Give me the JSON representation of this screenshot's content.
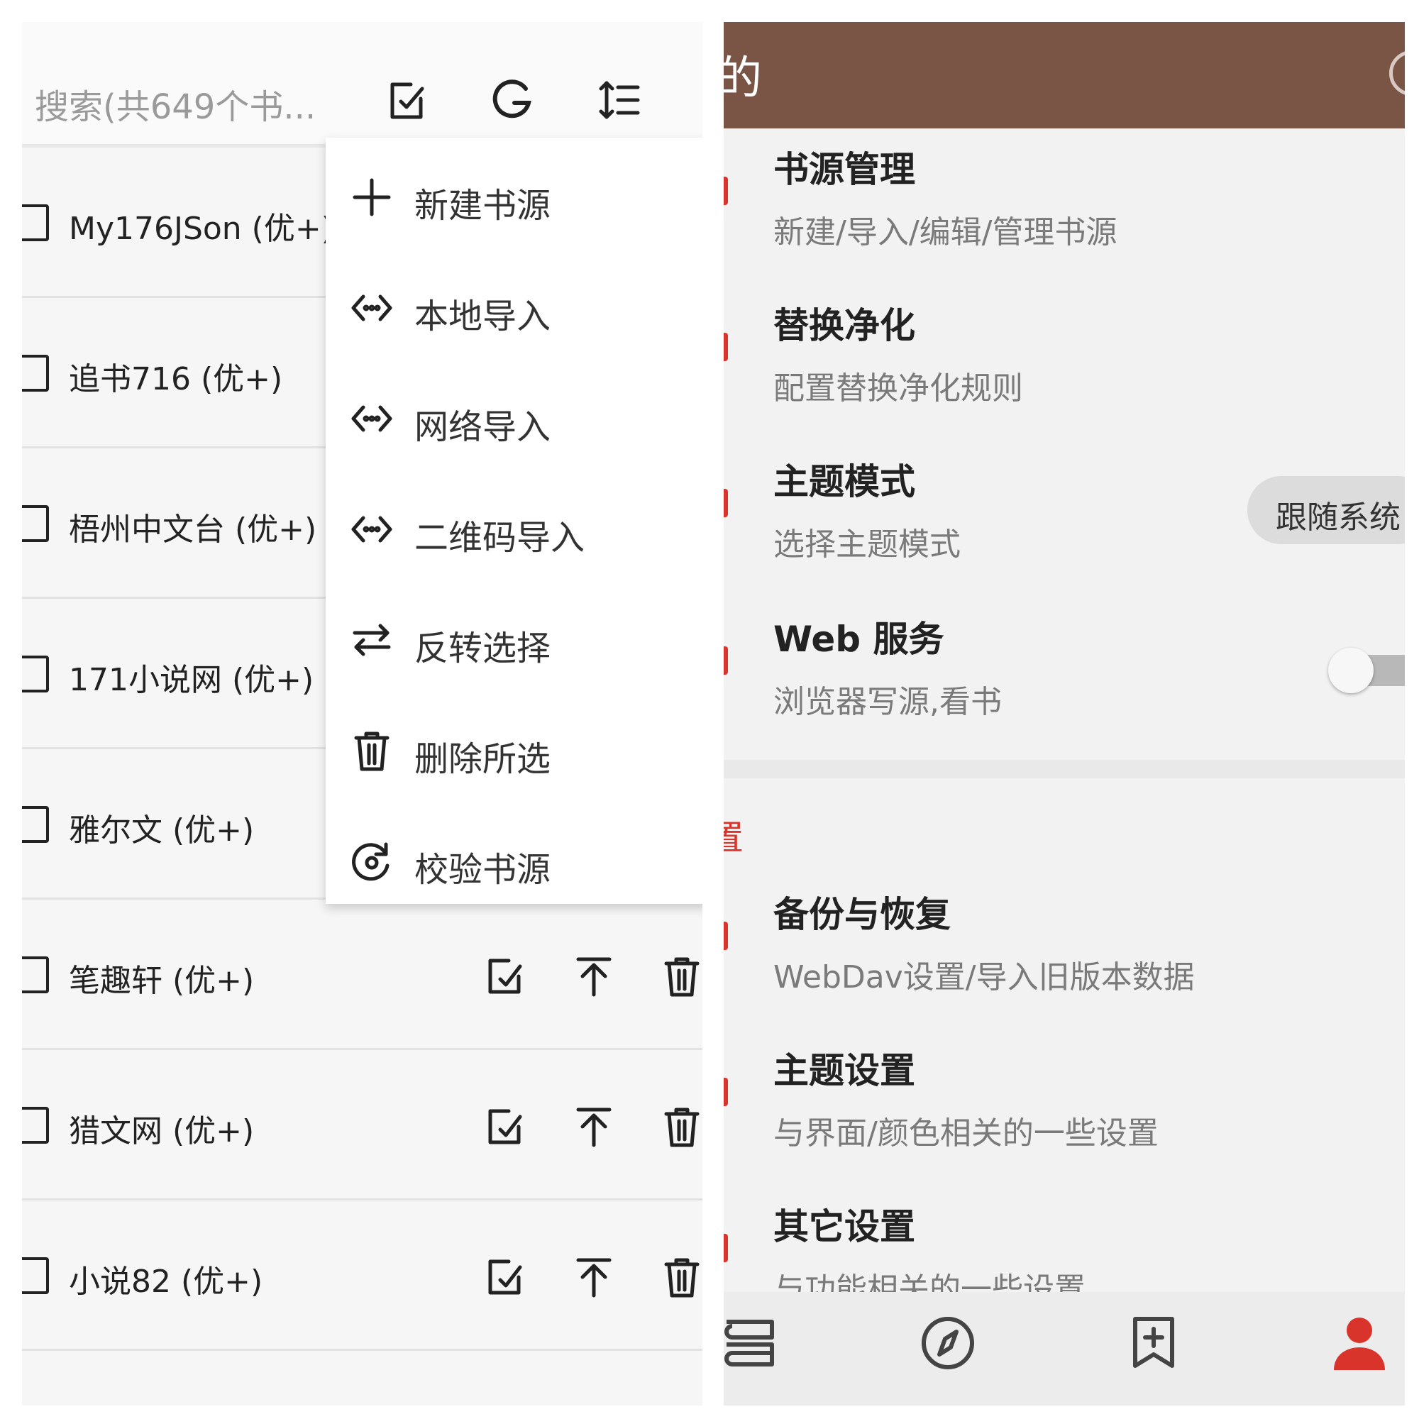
{
  "left": {
    "search_placeholder": "搜索(共649个书...",
    "toolbar_icons": [
      "edit-icon",
      "g-icon",
      "sort-icon"
    ],
    "sources": [
      {
        "name": "My176JSon (优+)"
      },
      {
        "name": "追书716 (优+)"
      },
      {
        "name": "梧州中文台 (优+)"
      },
      {
        "name": "171小说网 (优+)"
      },
      {
        "name": "雅尔文 (优+)"
      },
      {
        "name": "笔趣轩 (优+)"
      },
      {
        "name": "猎文网 (优+)"
      },
      {
        "name": "小说82 (优+)"
      }
    ],
    "menu": [
      {
        "label": "新建书源",
        "icon": "plus-icon"
      },
      {
        "label": "本地导入",
        "icon": "code-import-icon"
      },
      {
        "label": "网络导入",
        "icon": "code-import-icon"
      },
      {
        "label": "二维码导入",
        "icon": "code-import-icon"
      },
      {
        "label": "反转选择",
        "icon": "swap-icon"
      },
      {
        "label": "删除所选",
        "icon": "trash-icon"
      },
      {
        "label": "校验书源",
        "icon": "refresh-check-icon"
      }
    ]
  },
  "right": {
    "appbar_title": "的",
    "settings": [
      {
        "title": "书源管理",
        "subtitle": "新建/导入/编辑/管理书源"
      },
      {
        "title": "替换净化",
        "subtitle": "配置替换净化规则"
      },
      {
        "title": "主题模式",
        "subtitle": "选择主题模式",
        "value": "跟随系统"
      },
      {
        "title": "Web 服务",
        "subtitle": "浏览器写源,看书",
        "switch_on": false
      }
    ],
    "group_label": "置",
    "settings2": [
      {
        "title": "备份与恢复",
        "subtitle": "WebDav设置/导入旧版本数据"
      },
      {
        "title": "主题设置",
        "subtitle": "与界面/颜色相关的一些设置"
      },
      {
        "title": "其它设置",
        "subtitle": "与功能相关的一些设置"
      }
    ],
    "bottom_nav": [
      "bookshelf-icon",
      "compass-icon",
      "bookmark-add-icon",
      "person-icon"
    ],
    "accent_color": "#d9342b",
    "appbar_color": "#7a5545"
  }
}
